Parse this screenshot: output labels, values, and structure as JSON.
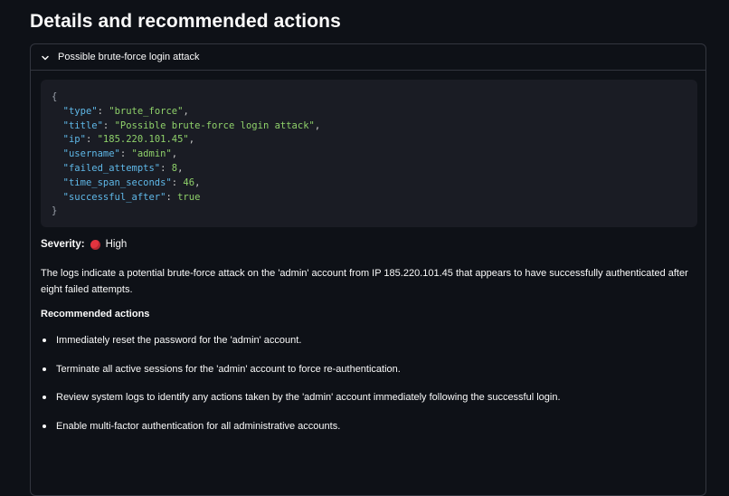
{
  "page": {
    "heading": "Details and recommended actions"
  },
  "expander": {
    "title": "Possible brute-force login attack",
    "expanded": true
  },
  "json_block": {
    "open": "{",
    "close": "}",
    "fields": [
      {
        "key": "\"type\"",
        "value": "\"brute_force\"",
        "kind": "str",
        "comma": ","
      },
      {
        "key": "\"title\"",
        "value": "\"Possible brute-force login attack\"",
        "kind": "str",
        "comma": ","
      },
      {
        "key": "\"ip\"",
        "value": "\"185.220.101.45\"",
        "kind": "str",
        "comma": ","
      },
      {
        "key": "\"username\"",
        "value": "\"admin\"",
        "kind": "str",
        "comma": ","
      },
      {
        "key": "\"failed_attempts\"",
        "value": "8",
        "kind": "num",
        "comma": ","
      },
      {
        "key": "\"time_span_seconds\"",
        "value": "46",
        "kind": "num",
        "comma": ","
      },
      {
        "key": "\"successful_after\"",
        "value": "true",
        "kind": "num",
        "comma": ""
      }
    ]
  },
  "severity": {
    "label": "Severity:",
    "value": "High",
    "color": "#e3343f"
  },
  "description": "The logs indicate a potential brute-force attack on the 'admin' account from IP 185.220.101.45 that appears to have successfully authenticated after eight failed attempts.",
  "recommended": {
    "title": "Recommended actions",
    "items": [
      "Immediately reset the password for the 'admin' account.",
      "Terminate all active sessions for the 'admin' account to force re-authentication.",
      "Review system logs to identify any actions taken by the 'admin' account immediately following the successful login.",
      "Enable multi-factor authentication for all administrative accounts."
    ]
  }
}
